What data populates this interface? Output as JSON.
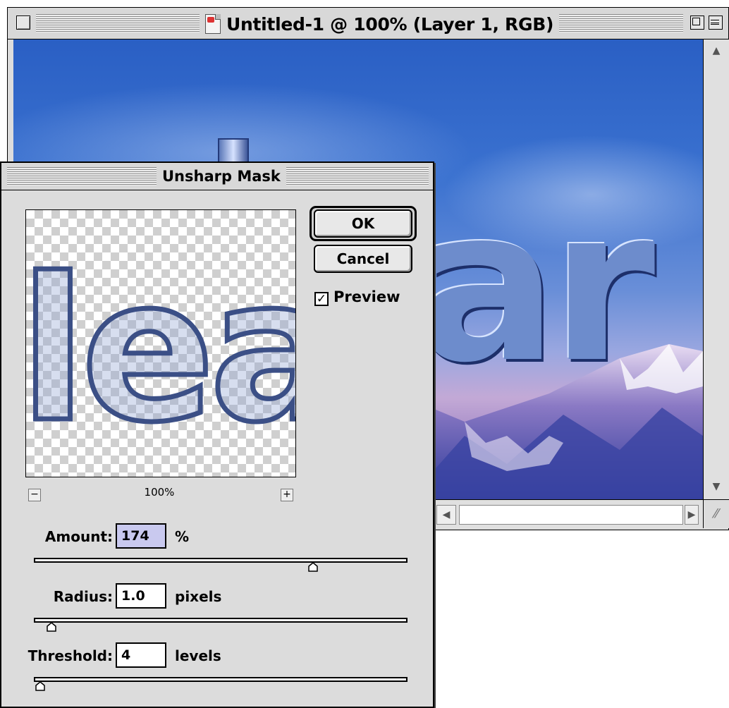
{
  "document_window": {
    "title": "Untitled-1 @ 100% (Layer 1, RGB)",
    "canvas_text": "ar"
  },
  "dialog": {
    "title": "Unsharp Mask",
    "preview_text": "lea",
    "ok_label": "OK",
    "cancel_label": "Cancel",
    "preview": {
      "label": "Preview",
      "checked": true
    },
    "zoom": {
      "minus": "−",
      "plus": "+",
      "level": "100%"
    },
    "amount": {
      "label": "Amount:",
      "value": "174",
      "unit": "%",
      "slider_fraction": 0.74
    },
    "radius": {
      "label": "Radius:",
      "value": "1.0",
      "unit": "pixels",
      "slider_fraction": 0.04
    },
    "threshold": {
      "label": "Threshold:",
      "value": "4",
      "unit": "levels",
      "slider_fraction": 0.01
    }
  },
  "colors": {
    "sky": "#3b72d0",
    "amount_highlight": "#c9c9ef",
    "dialog_bg": "#dcdcdc"
  }
}
